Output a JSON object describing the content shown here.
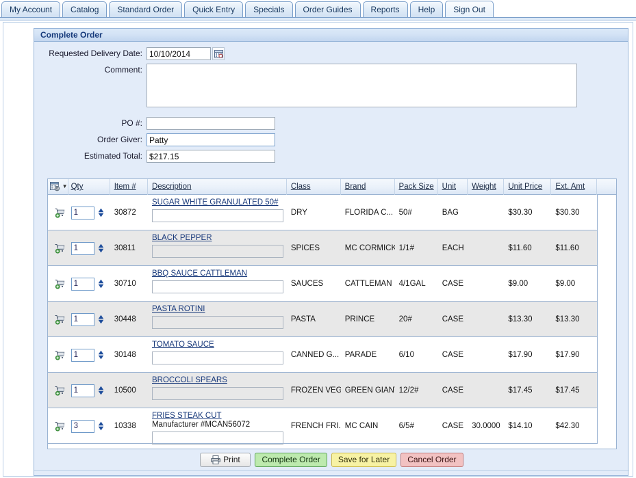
{
  "tabs": [
    {
      "label": "My Account",
      "selected": false
    },
    {
      "label": "Catalog",
      "selected": false
    },
    {
      "label": "Standard Order",
      "selected": false
    },
    {
      "label": "Quick Entry",
      "selected": false
    },
    {
      "label": "Specials",
      "selected": false
    },
    {
      "label": "Order Guides",
      "selected": false
    },
    {
      "label": "Reports",
      "selected": false
    },
    {
      "label": "Help",
      "selected": false
    },
    {
      "label": "Sign Out",
      "selected": true
    }
  ],
  "panel": {
    "title": "Complete Order"
  },
  "form": {
    "delivery_date_label": "Requested Delivery Date:",
    "delivery_date_value": "10/10/2014",
    "calendar_icon": "calendar-icon",
    "comment_label": "Comment:",
    "comment_value": "",
    "comment_placeholder": "",
    "po_label": "PO #:",
    "po_value": "",
    "order_giver_label": "Order Giver:",
    "order_giver_value": "Patty",
    "estimated_total_label": "Estimated Total:",
    "estimated_total_value": "$217.15"
  },
  "grid": {
    "menu_icon": "grid-settings-icon",
    "columns": [
      "Qty",
      "Item #",
      "Description",
      "Class",
      "Brand",
      "Pack Size",
      "Unit",
      "Weight",
      "Unit Price",
      "Ext. Amt"
    ],
    "rows": [
      {
        "cart_icon": "add-to-cart-icon",
        "qty": "1",
        "item": "30872",
        "description": "SUGAR WHITE GRANULATED 50#",
        "manufacturer": "",
        "note": "",
        "class": "DRY",
        "brand": "FLORIDA C...",
        "pack_size": "50#",
        "unit": "BAG",
        "weight": "",
        "unit_price": "$30.30",
        "ext_amt": "$30.30"
      },
      {
        "cart_icon": "add-to-cart-icon",
        "qty": "1",
        "item": "30811",
        "description": "BLACK PEPPER",
        "manufacturer": "",
        "note": "",
        "class": "SPICES",
        "brand": "MC CORMICK",
        "pack_size": "1/1#",
        "unit": "EACH",
        "weight": "",
        "unit_price": "$11.60",
        "ext_amt": "$11.60"
      },
      {
        "cart_icon": "add-to-cart-icon",
        "qty": "1",
        "item": "30710",
        "description": "BBQ SAUCE CATTLEMAN",
        "manufacturer": "",
        "note": "",
        "class": "SAUCES",
        "brand": "CATTLEMAN",
        "pack_size": "4/1GAL",
        "unit": "CASE",
        "weight": "",
        "unit_price": "$9.00",
        "ext_amt": "$9.00"
      },
      {
        "cart_icon": "add-to-cart-icon",
        "qty": "1",
        "item": "30448",
        "description": "PASTA ROTINI",
        "manufacturer": "",
        "note": "",
        "class": "PASTA",
        "brand": "PRINCE",
        "pack_size": "20#",
        "unit": "CASE",
        "weight": "",
        "unit_price": "$13.30",
        "ext_amt": "$13.30"
      },
      {
        "cart_icon": "add-to-cart-icon",
        "qty": "1",
        "item": "30148",
        "description": "TOMATO SAUCE",
        "manufacturer": "",
        "note": "",
        "class": "CANNED G...",
        "brand": "PARADE",
        "pack_size": "6/10",
        "unit": "CASE",
        "weight": "",
        "unit_price": "$17.90",
        "ext_amt": "$17.90"
      },
      {
        "cart_icon": "add-to-cart-icon",
        "qty": "1",
        "item": "10500",
        "description": "BROCCOLI SPEARS",
        "manufacturer": "",
        "note": "",
        "class": "FROZEN VEG",
        "brand": "GREEN GIANT",
        "pack_size": "12/2#",
        "unit": "CASE",
        "weight": "",
        "unit_price": "$17.45",
        "ext_amt": "$17.45"
      },
      {
        "cart_icon": "add-to-cart-icon",
        "qty": "3",
        "item": "10338",
        "description": "FRIES STEAK CUT",
        "manufacturer": "Manufacturer #MCAN56072",
        "note": "",
        "class": "FRENCH FRI...",
        "brand": "MC CAIN",
        "pack_size": "6/5#",
        "unit": "CASE",
        "weight": "30.0000",
        "unit_price": "$14.10",
        "ext_amt": "$42.30"
      }
    ]
  },
  "buttons": {
    "print": "Print",
    "print_icon": "printer-icon",
    "complete": "Complete Order",
    "save": "Save for Later",
    "cancel": "Cancel Order"
  },
  "colors": {
    "accent": "#15397a",
    "panel_bg": "#e3ecf9",
    "green": "#bdeaae",
    "yellow": "#f7f2a4",
    "red": "#f2c2c2"
  }
}
